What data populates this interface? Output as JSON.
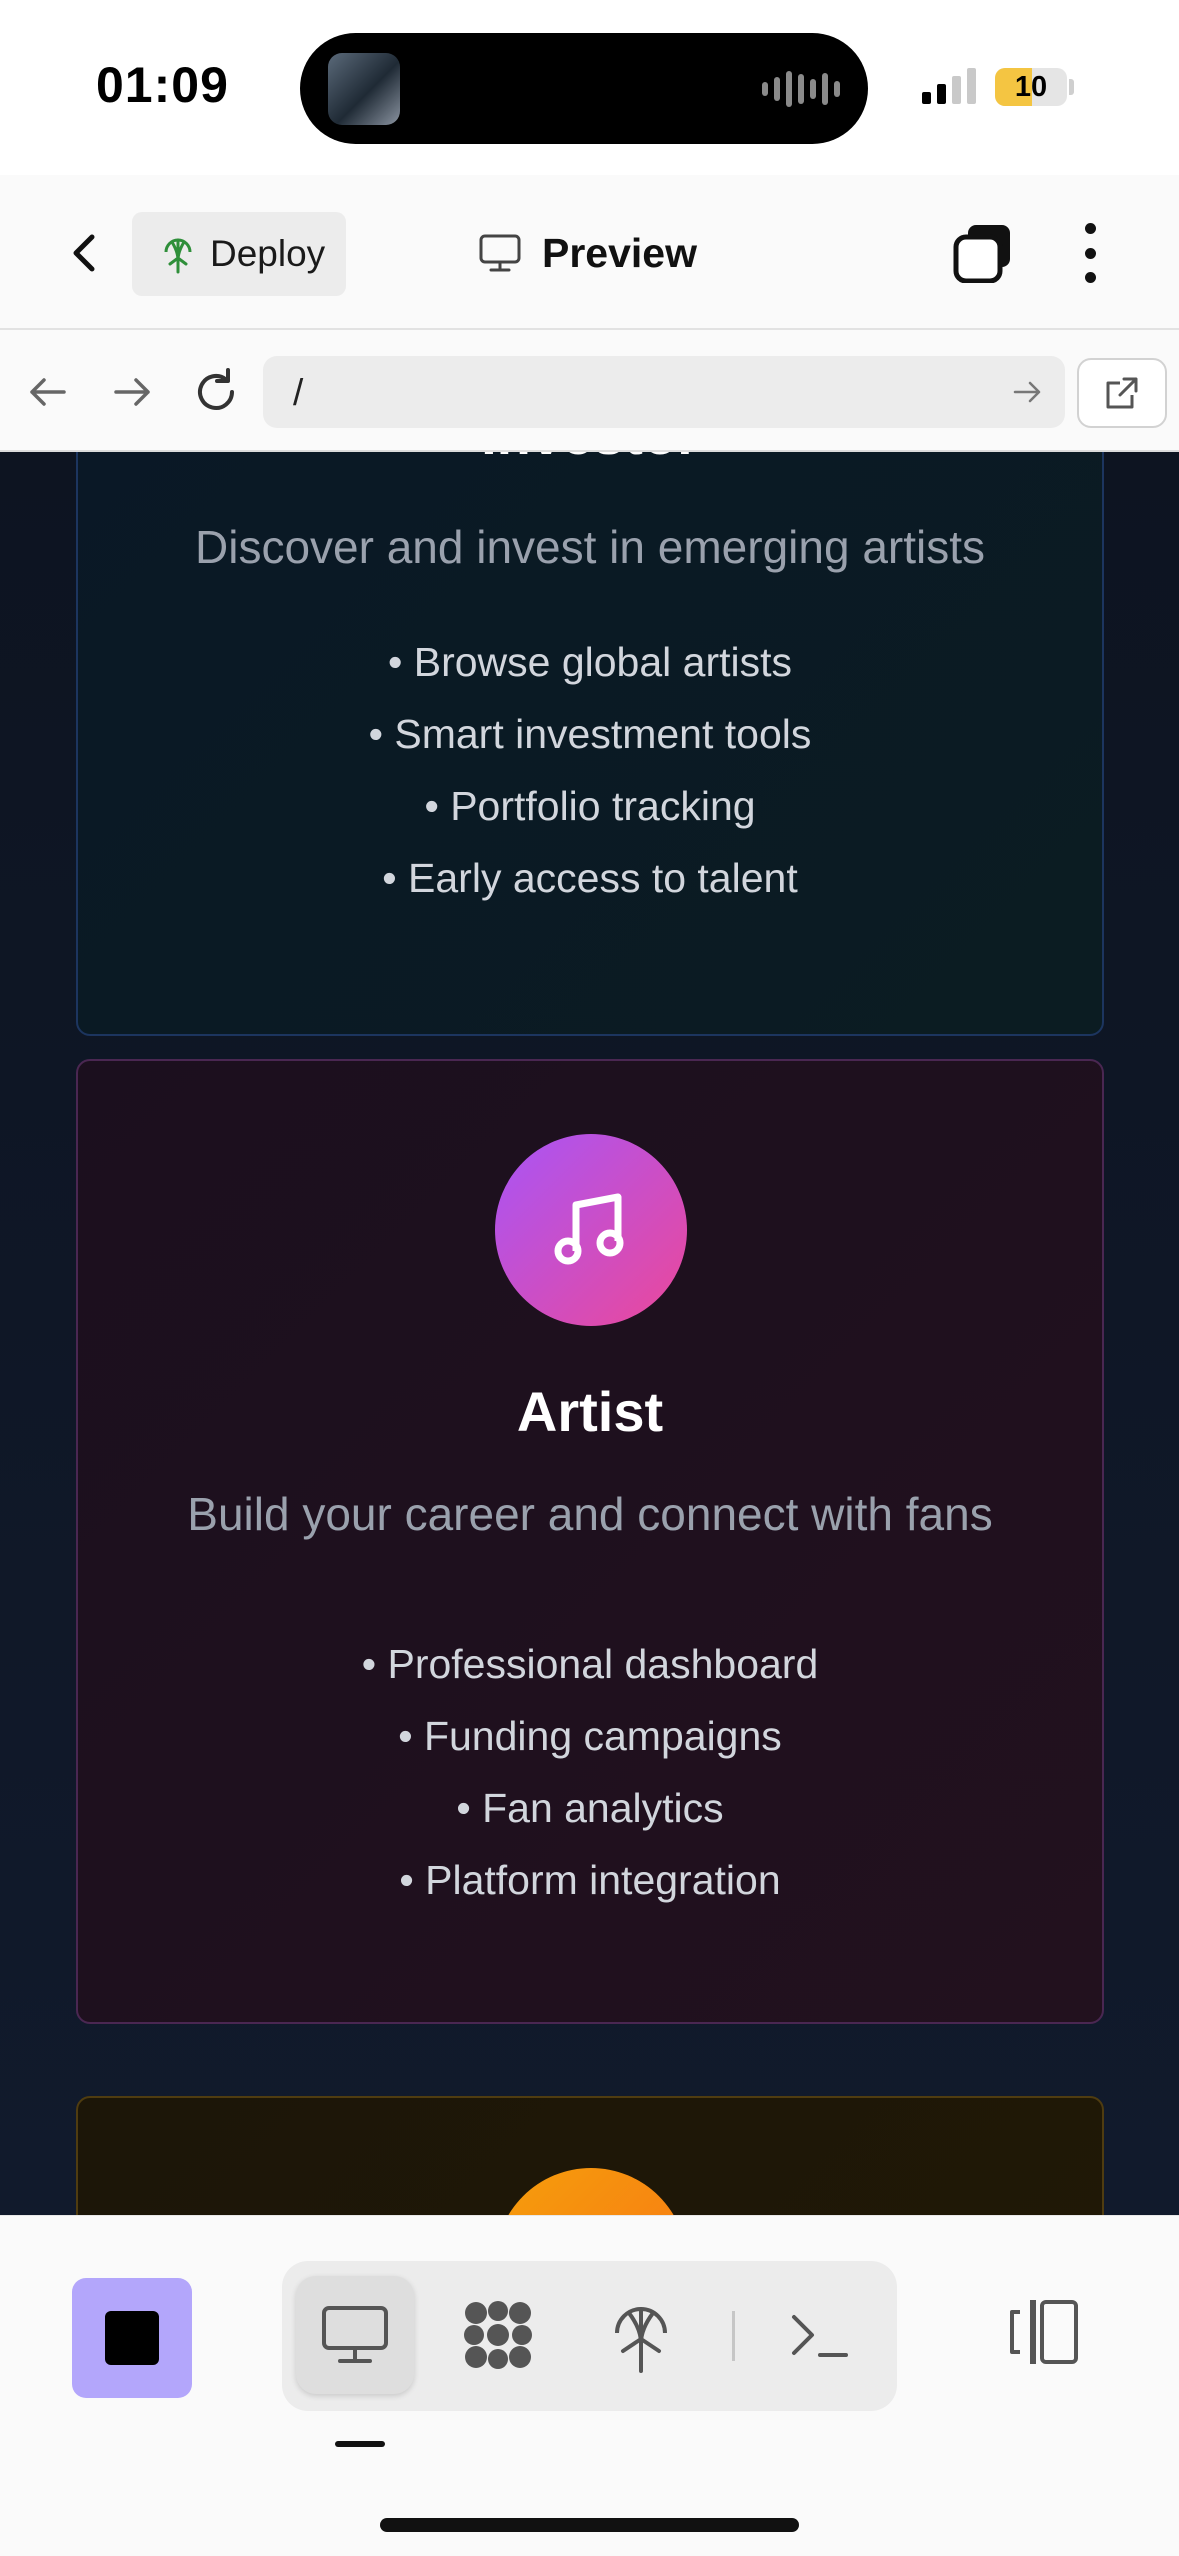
{
  "status_bar": {
    "time": "01:09",
    "battery_level": "10",
    "battery_color": "#f4c542"
  },
  "header": {
    "deploy_label": "Deploy",
    "preview_label": "Preview",
    "icons": [
      "chevron-left-icon",
      "globe-tree-icon",
      "monitor-icon",
      "stacked-squares-icon",
      "more-vertical-icon"
    ]
  },
  "browser": {
    "url": "/",
    "icons": [
      "arrow-left-icon",
      "arrow-right-icon",
      "reload-icon",
      "go-arrow-icon",
      "external-link-icon"
    ]
  },
  "content": {
    "investor": {
      "title": "Investor",
      "description": "Discover and invest in emerging artists",
      "features": [
        "Browse global artists",
        "Smart investment tools",
        "Portfolio tracking",
        "Early access to talent"
      ]
    },
    "artist": {
      "title": "Artist",
      "description": "Build your career and connect with fans",
      "features": [
        "Professional dashboard",
        "Funding campaigns",
        "Fan analytics",
        "Platform integration"
      ],
      "icon": "music-note-icon",
      "icon_gradient": [
        "#a855f7",
        "#ec4899"
      ]
    },
    "third_card": {
      "icon_gradient": [
        "#f59e0b",
        "#f97316"
      ]
    }
  },
  "toolbar": {
    "accent_color": "#b3a6fb",
    "tools": [
      "desktop-preview-icon",
      "shapes-grid-icon",
      "deploy-icon",
      "terminal-icon"
    ],
    "panel_icon": "panel-toggle-icon"
  }
}
